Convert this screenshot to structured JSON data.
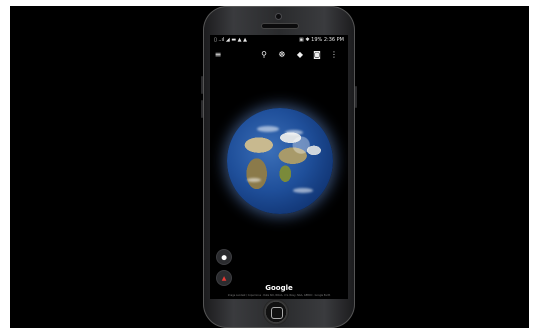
{
  "statusbar": {
    "left": "▯ ..ıl ◢  ▬ ▲ ▲",
    "right": "▣ ✱ 19%  2:36 PM"
  },
  "toolbar": {
    "menu_icon": "≡",
    "search_icon": "⚲",
    "voyager_icon": "☸",
    "random_icon": "◆",
    "camera_icon": "◙",
    "more_icon": "⋮"
  },
  "map": {
    "brand": "Google",
    "attribution": "Image Landsat / Copernicus · Data SIO, NOAA, U.S. Navy, NGA, GEBCO · Google Earth"
  },
  "fabs": {
    "location_icon": "⬤",
    "compass_icon": "▲"
  }
}
